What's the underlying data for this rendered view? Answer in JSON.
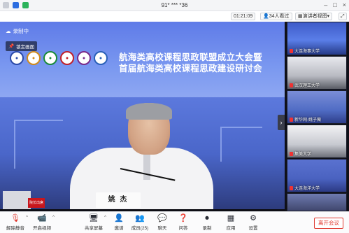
{
  "window": {
    "title": "91* *** *36"
  },
  "toolbar": {
    "timer": "01:21:09",
    "viewers": "34人看过",
    "view_mode": "演讲者视图"
  },
  "stage": {
    "recording_label": "录制中",
    "pin_label": "锁定画面",
    "banner_line1": "航海类高校课程思政联盟成立大会暨",
    "banner_line2": "首届航海类高校课程思政建设研讨会",
    "nameplate": "姚 杰",
    "red_sign": "院长出席"
  },
  "sidebar": {
    "participants": [
      {
        "name": "大连海事大学"
      },
      {
        "name": "武汉理工大学"
      },
      {
        "name": "新华网-姚子薇"
      },
      {
        "name": "集美大学"
      },
      {
        "name": "大连海洋大学"
      }
    ]
  },
  "controls": {
    "mute": "解除静音",
    "video": "开启视频",
    "share": "共享屏幕",
    "invite": "邀请",
    "members": "成员(25)",
    "chat": "聊天",
    "qa": "问答",
    "record": "录制",
    "apps": "应用",
    "settings": "设置",
    "leave": "离开会议"
  },
  "colors": {
    "accent": "#e0392f",
    "banner": "#6a86ea"
  }
}
